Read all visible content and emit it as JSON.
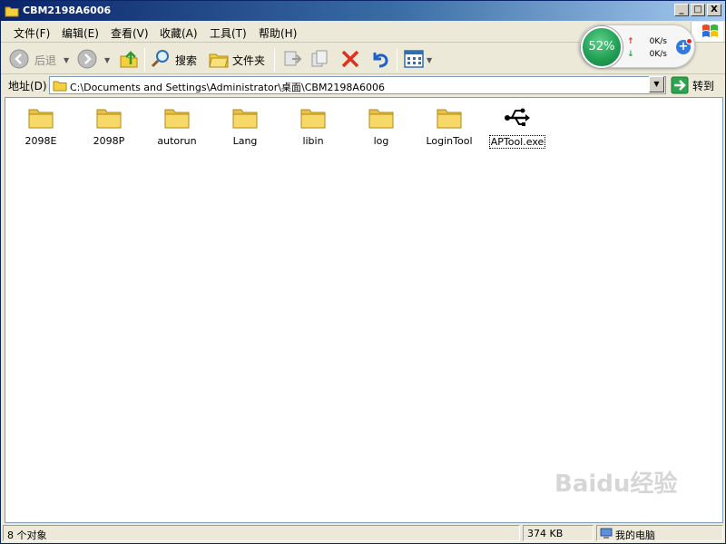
{
  "window": {
    "title": "CBM2198A6006",
    "controls": {
      "minimize": "_",
      "maximize": "□",
      "close": "X"
    }
  },
  "menu": [
    "文件(F)",
    "编辑(E)",
    "查看(V)",
    "收藏(A)",
    "工具(T)",
    "帮助(H)"
  ],
  "toolbar": {
    "back_label": "后退",
    "search_label": "搜索",
    "folders_label": "文件夹"
  },
  "speed_widget": {
    "percent": "52%",
    "upload": "0K/s",
    "download": "0K/s"
  },
  "address": {
    "label": "地址(D)",
    "path": "C:\\Documents and Settings\\Administrator\\桌面\\CBM2198A6006",
    "go_label": "转到"
  },
  "files": [
    {
      "name": "2098E",
      "type": "folder"
    },
    {
      "name": "2098P",
      "type": "folder"
    },
    {
      "name": "autorun",
      "type": "folder"
    },
    {
      "name": "Lang",
      "type": "folder"
    },
    {
      "name": "libin",
      "type": "folder"
    },
    {
      "name": "log",
      "type": "folder"
    },
    {
      "name": "LoginTool",
      "type": "folder"
    },
    {
      "name": "APTool.exe",
      "type": "usb-exe"
    }
  ],
  "status": {
    "count": "8 个对象",
    "size": "374 KB",
    "location": "我的电脑"
  },
  "watermark": "Baidu经验"
}
